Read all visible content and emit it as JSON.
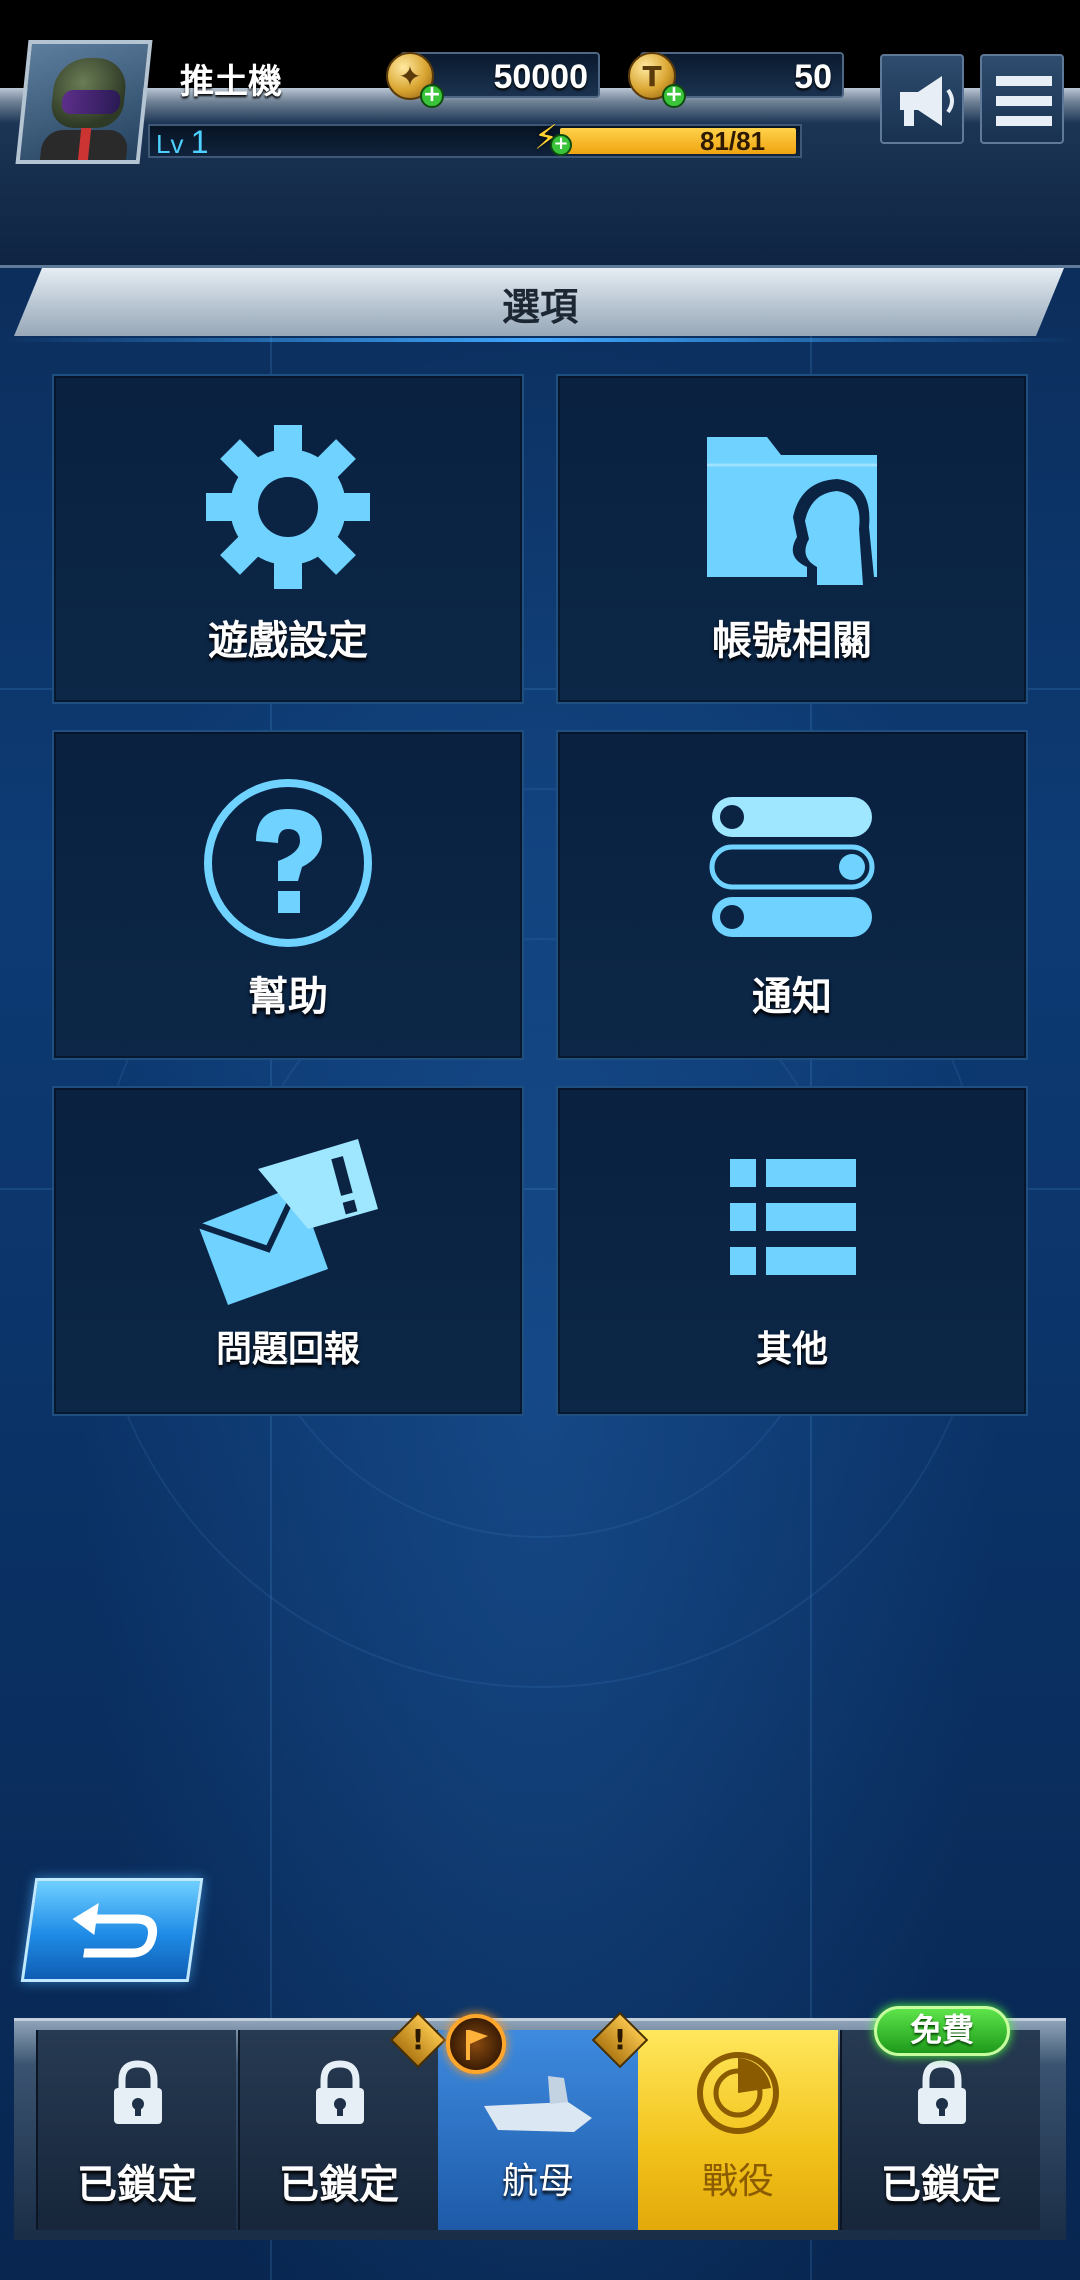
{
  "header": {
    "player_name": "推土機",
    "level_label": "Lv",
    "level_value": "1",
    "gold": "50000",
    "tokens": "50",
    "energy": "81/81",
    "energy_fraction": 1.0
  },
  "title": "選項",
  "options": [
    {
      "label": "遊戲設定",
      "icon": "gear-icon"
    },
    {
      "label": "帳號相關",
      "icon": "account-folder-icon"
    },
    {
      "label": "幫助",
      "icon": "help-icon"
    },
    {
      "label": "通知",
      "icon": "toggle-switches-icon"
    },
    {
      "label": "問題回報",
      "icon": "report-mail-icon"
    },
    {
      "label": "其他",
      "icon": "list-icon"
    }
  ],
  "bottom_nav": [
    {
      "label": "已鎖定",
      "state": "locked"
    },
    {
      "label": "已鎖定",
      "state": "locked"
    },
    {
      "label": "航母",
      "state": "active"
    },
    {
      "label": "戰役",
      "state": "campaign"
    },
    {
      "label": "已鎖定",
      "state": "locked",
      "badge": "免費"
    }
  ],
  "colors": {
    "accent_blue": "#6fd2ff",
    "energy_yellow": "#f0a411",
    "campaign_yellow": "#f2c21a",
    "free_green": "#1e9a1b"
  }
}
